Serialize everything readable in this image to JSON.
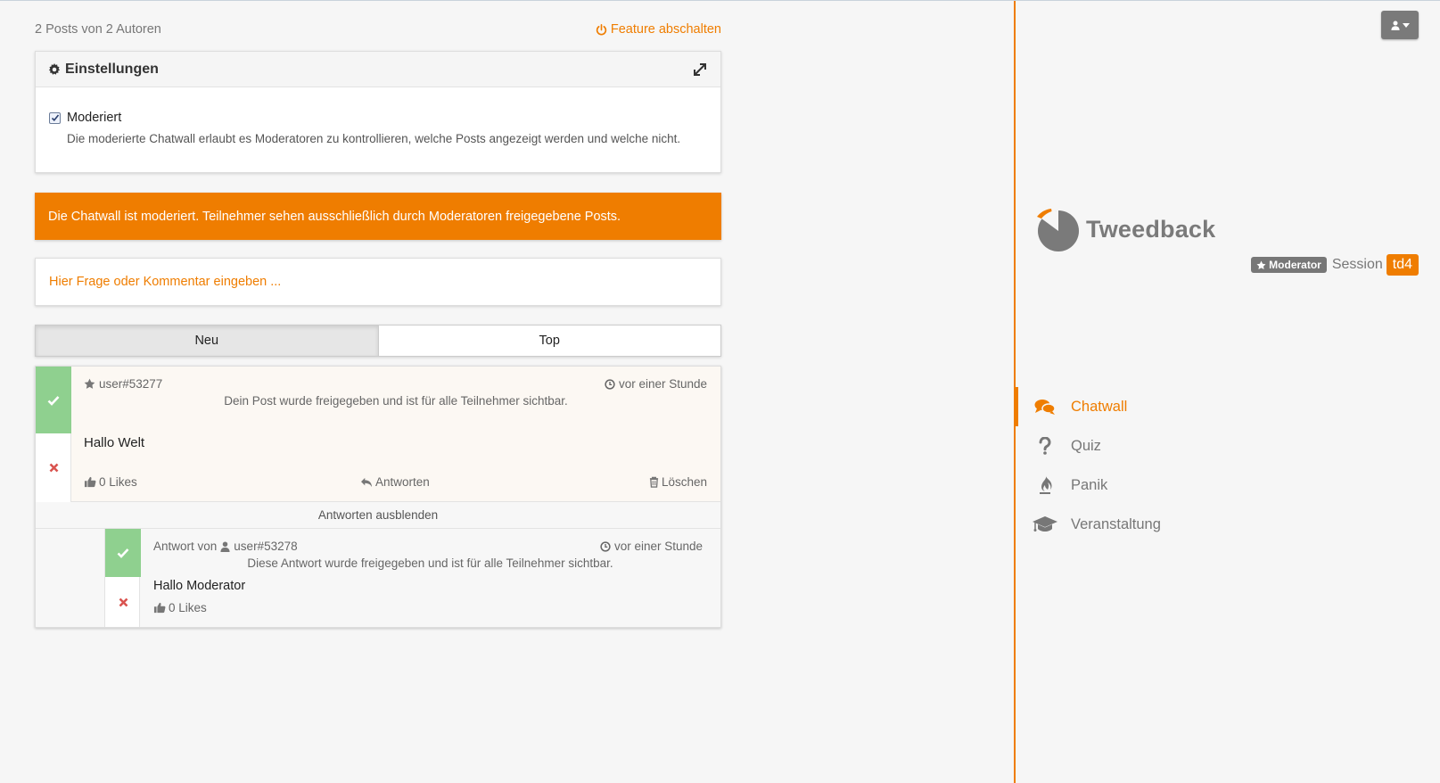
{
  "header": {
    "post_count": "2 Posts von 2 Autoren",
    "feature_off": "Feature abschalten"
  },
  "settings": {
    "title": "Einstellungen",
    "moderated_label": "Moderiert",
    "moderated_checked": true,
    "description": "Die moderierte Chatwall erlaubt es Moderatoren zu kontrollieren, welche Posts angezeigt werden und welche nicht."
  },
  "banner": {
    "text": "Die Chatwall ist moderiert. Teilnehmer sehen ausschließlich durch Moderatoren freigegebene Posts."
  },
  "input": {
    "placeholder": "Hier Frage oder Kommentar eingeben ..."
  },
  "tabs": [
    {
      "label": "Neu",
      "active": true
    },
    {
      "label": "Top",
      "active": false
    }
  ],
  "post": {
    "author": "user#53277",
    "time": "vor einer Stunde",
    "status": "Dein Post wurde freigegeben und ist für alle Teilnehmer sichtbar.",
    "text": "Hallo Welt",
    "likes": "0 Likes",
    "reply_label": "Antworten",
    "delete_label": "Löschen"
  },
  "hide_replies": "Antworten ausblenden",
  "reply": {
    "prefix": "Antwort von",
    "author": "user#53278",
    "time": "vor einer Stunde",
    "status": "Diese Antwort wurde freigegeben und ist für alle Teilnehmer sichtbar.",
    "text": "Hallo Moderator",
    "likes": "0 Likes"
  },
  "sidebar": {
    "logo_text": "Tweedback",
    "role_badge": "Moderator",
    "session_label": "Session",
    "session_code": "td4",
    "nav": [
      {
        "label": "Chatwall",
        "icon": "comments-icon",
        "active": true
      },
      {
        "label": "Quiz",
        "icon": "question-icon",
        "active": false
      },
      {
        "label": "Panik",
        "icon": "fire-icon",
        "active": false
      },
      {
        "label": "Veranstaltung",
        "icon": "graduation-cap-icon",
        "active": false
      }
    ]
  },
  "colors": {
    "accent": "#ef7d00",
    "approve": "#8fd08f",
    "reject": "#d9534f",
    "gray": "#777777"
  }
}
